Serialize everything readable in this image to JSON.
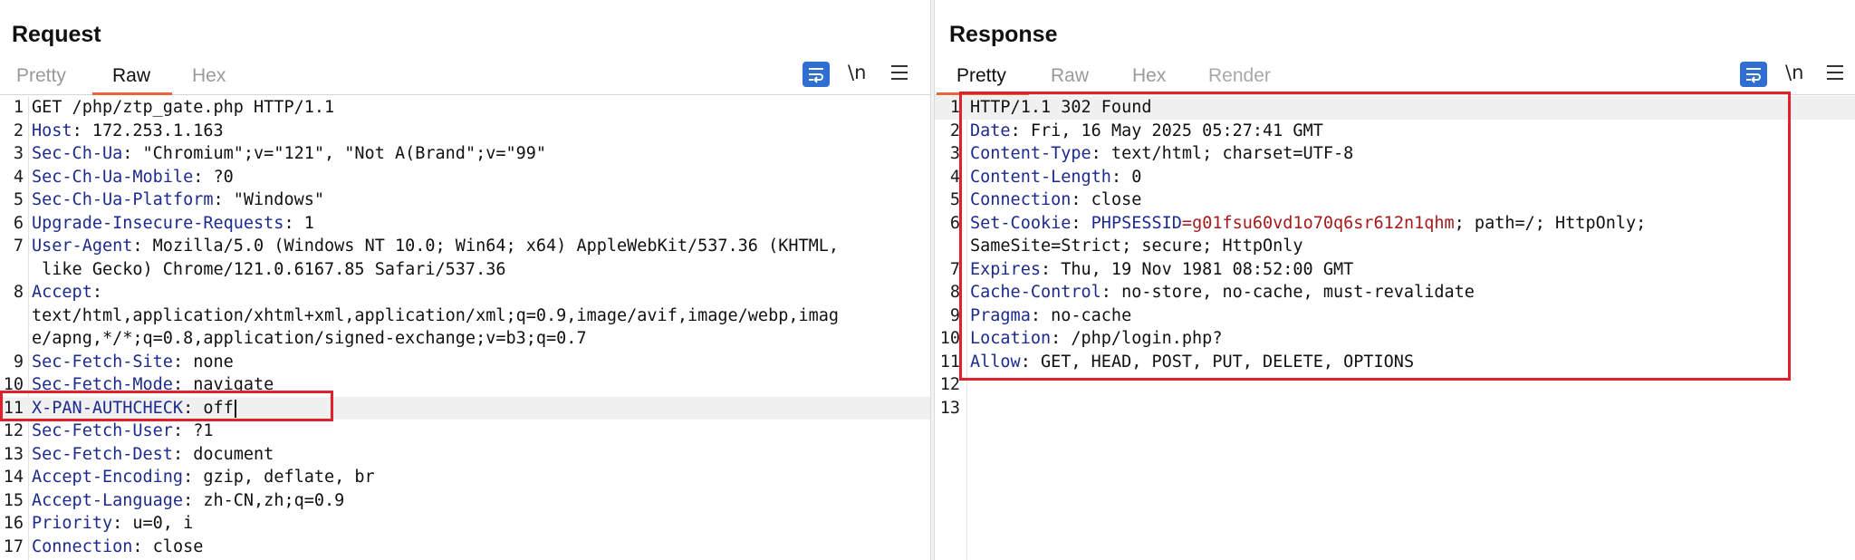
{
  "request": {
    "title": "Request",
    "tabs": [
      "Pretty",
      "Raw",
      "Hex"
    ],
    "active_tab": "Raw",
    "newline_toggle": "\\n",
    "lines": [
      {
        "n": "1",
        "key": "",
        "value": "GET /php/ztp_gate.php HTTP/1.1"
      },
      {
        "n": "2",
        "key": "Host",
        "value": ": 172.253.1.163"
      },
      {
        "n": "3",
        "key": "Sec-Ch-Ua",
        "value": ": \"Chromium\";v=\"121\", \"Not A(Brand\";v=\"99\""
      },
      {
        "n": "4",
        "key": "Sec-Ch-Ua-Mobile",
        "value": ": ?0"
      },
      {
        "n": "5",
        "key": "Sec-Ch-Ua-Platform",
        "value": ": \"Windows\""
      },
      {
        "n": "6",
        "key": "Upgrade-Insecure-Requests",
        "value": ": 1"
      },
      {
        "n": "7",
        "key": "User-Agent",
        "value": ": Mozilla/5.0 (Windows NT 10.0; Win64; x64) AppleWebKit/537.36 (KHTML,"
      },
      {
        "n": "",
        "key": "",
        "value": " like Gecko) Chrome/121.0.6167.85 Safari/537.36"
      },
      {
        "n": "8",
        "key": "Accept",
        "value": ":"
      },
      {
        "n": "",
        "key": "",
        "value": "text/html,application/xhtml+xml,application/xml;q=0.9,image/avif,image/webp,imag"
      },
      {
        "n": "",
        "key": "",
        "value": "e/apng,*/*;q=0.8,application/signed-exchange;v=b3;q=0.7"
      },
      {
        "n": "9",
        "key": "Sec-Fetch-Site",
        "value": ": none"
      },
      {
        "n": "10",
        "key": "Sec-Fetch-Mode",
        "value": ": navigate"
      },
      {
        "n": "11",
        "key": "X-PAN-AUTHCHECK",
        "value": ": off"
      },
      {
        "n": "12",
        "key": "Sec-Fetch-User",
        "value": ": ?1"
      },
      {
        "n": "13",
        "key": "Sec-Fetch-Dest",
        "value": ": document"
      },
      {
        "n": "14",
        "key": "Accept-Encoding",
        "value": ": gzip, deflate, br"
      },
      {
        "n": "15",
        "key": "Accept-Language",
        "value": ": zh-CN,zh;q=0.9"
      },
      {
        "n": "16",
        "key": "Priority",
        "value": ": u=0, i"
      },
      {
        "n": "17",
        "key": "Connection",
        "value": ": close"
      }
    ]
  },
  "response": {
    "title": "Response",
    "tabs": [
      "Pretty",
      "Raw",
      "Hex",
      "Render"
    ],
    "active_tab": "Pretty",
    "newline_toggle": "\\n",
    "lines": [
      {
        "n": "1",
        "key": "",
        "value": "HTTP/1.1 302 Found"
      },
      {
        "n": "2",
        "key": "Date",
        "value": ": Fri, 16 May 2025 05:27:41 GMT"
      },
      {
        "n": "3",
        "key": "Content-Type",
        "value": ": text/html; charset=UTF-8"
      },
      {
        "n": "4",
        "key": "Content-Length",
        "value": ": 0"
      },
      {
        "n": "5",
        "key": "Connection",
        "value": ": close"
      },
      {
        "n": "6",
        "key": "Set-Cookie",
        "value": ": ",
        "cookie_name": "PHPSESSID",
        "cookie_eq": "=",
        "cookie_value": "g01fsu60vd1o70q6sr612n1qhm",
        "rest": "; path=/; HttpOnly;"
      },
      {
        "n": "",
        "key": "",
        "value": "SameSite=Strict; secure; HttpOnly"
      },
      {
        "n": "7",
        "key": "Expires",
        "value": ": Thu, 19 Nov 1981 08:52:00 GMT"
      },
      {
        "n": "8",
        "key": "Cache-Control",
        "value": ": no-store, no-cache, must-revalidate"
      },
      {
        "n": "9",
        "key": "Pragma",
        "value": ": no-cache"
      },
      {
        "n": "10",
        "key": "Location",
        "value": ": /php/login.php?"
      },
      {
        "n": "11",
        "key": "Allow",
        "value": ": GET, HEAD, POST, PUT, DELETE, OPTIONS"
      },
      {
        "n": "12",
        "key": "",
        "value": ""
      },
      {
        "n": "13",
        "key": "",
        "value": ""
      }
    ]
  },
  "colors": {
    "accent": "#2f6fd1",
    "tab_underline": "#e8643a",
    "header_key": "#1d2b8f",
    "cookie_name": "#1d2b8f",
    "cookie_value": "#a51a1a",
    "highlight_box": "#e0202a"
  },
  "icons": [
    "layout-split-horizontal-icon",
    "layout-split-vertical-icon",
    "layout-single-icon",
    "word-wrap-icon",
    "menu-icon"
  ]
}
